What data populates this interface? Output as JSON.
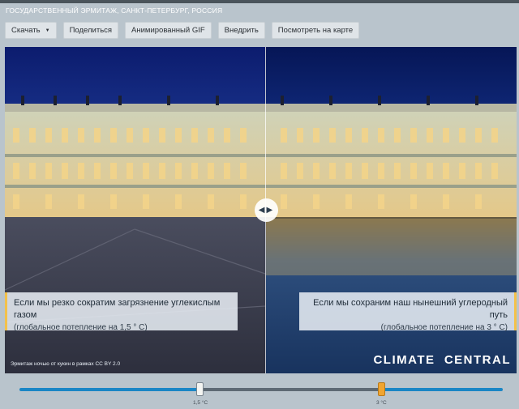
{
  "location": "ГОСУДАРСТВЕННЫЙ ЭРМИТАЖ, САНКТ-ПЕТЕРБУРГ, РОССИЯ",
  "toolbar": {
    "download": "Скачать",
    "share": "Поделиться",
    "gif": "Анимированный GIF",
    "embed": "Внедрить",
    "map": "Посмотреть на карте"
  },
  "captions": {
    "left_main": "Если мы резко сократим загрязнение углекислым газом",
    "left_sub": "(глобальное потепление на 1,5 ° C)",
    "right_main": "Если мы сохраним наш нынешний углеродный путь",
    "right_sub": "(глобальное потепление на 3 ° C)"
  },
  "credit": "Эрмитаж ночью от кукин в рамках CC BY 2.0",
  "brand": "CLIMATE  CENTRAL",
  "slider": {
    "label_a": "1,5 °C",
    "label_b": "3 °C"
  },
  "icons": {
    "handle": "compare-arrows-icon",
    "dropdown": "caret-down-icon"
  }
}
